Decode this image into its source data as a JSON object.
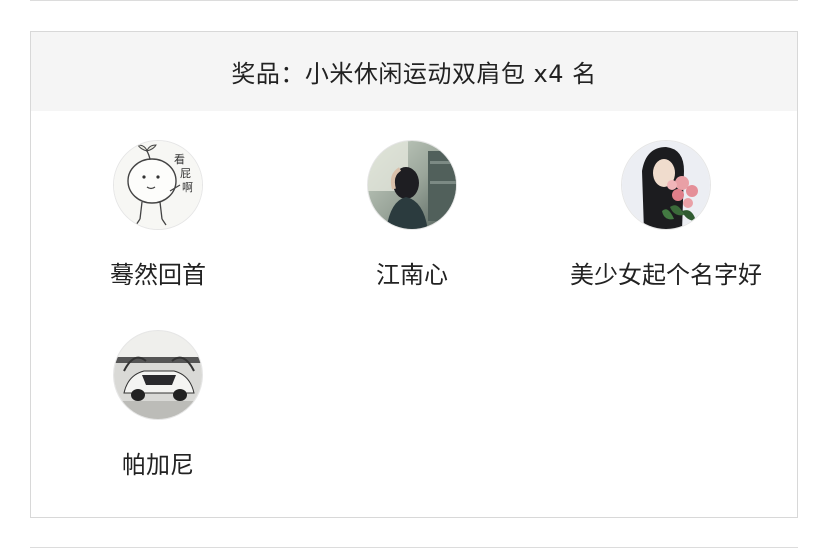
{
  "prize": {
    "title": "奖品：小米休闲运动双肩包 x4 名"
  },
  "winners": [
    {
      "name": "蓦然回首",
      "avatar_icon": "doodle-avatar-icon",
      "avatar_text": "看屁啊"
    },
    {
      "name": "江南心",
      "avatar_icon": "girl-photo-avatar-icon"
    },
    {
      "name": "美少女起个名字好",
      "avatar_icon": "girl-roses-avatar-icon"
    },
    {
      "name": "帕加尼",
      "avatar_icon": "supercar-avatar-icon"
    }
  ],
  "colors": {
    "header_bg": "#f5f5f5",
    "border": "#d8d8d8",
    "text": "#222222"
  }
}
